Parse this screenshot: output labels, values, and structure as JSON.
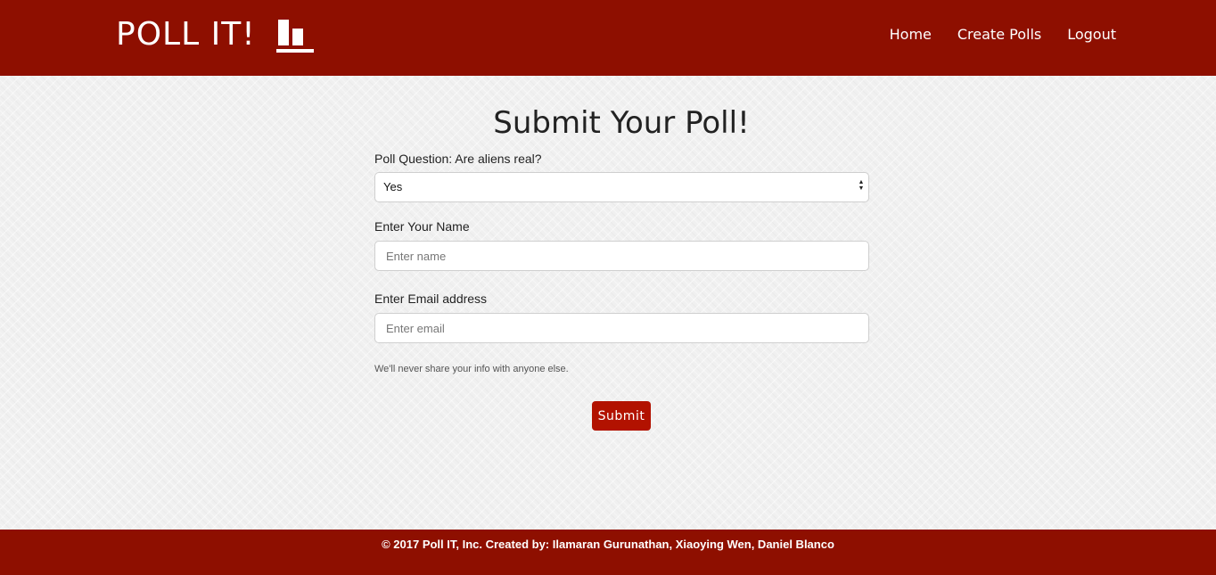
{
  "header": {
    "brand": "POLL IT!",
    "brand_icon": "bar-chart-icon",
    "nav": [
      {
        "label": "Home"
      },
      {
        "label": "Create Polls"
      },
      {
        "label": "Logout"
      }
    ]
  },
  "main": {
    "title": "Submit Your Poll!",
    "question_label": "Poll Question: Are aliens real?",
    "answer_select": {
      "value": "Yes"
    },
    "name_label": "Enter Your Name",
    "name_input": {
      "value": "",
      "placeholder": "Enter name"
    },
    "email_label": "Enter Email address",
    "email_input": {
      "value": "",
      "placeholder": "Enter email"
    },
    "help_text": "We'll never share your info with anyone else.",
    "submit_label": "Submit"
  },
  "footer": {
    "text": "© 2017 Poll IT, Inc. Created by: Ilamaran Gurunathan, Xiaoying Wen, Daniel Blanco"
  },
  "colors": {
    "header_bg": "#8e0f00",
    "button_bg": "#b21200",
    "page_bg": "#f0f0f0"
  }
}
